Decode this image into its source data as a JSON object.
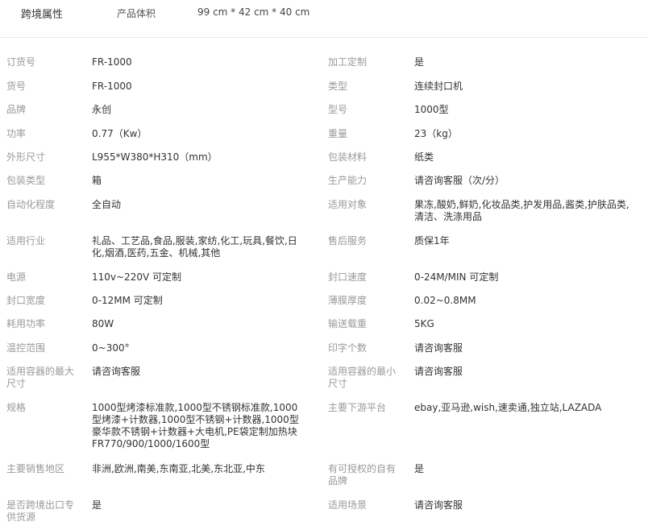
{
  "header": {
    "title": "跨境属性",
    "label": "产品体积",
    "value": "99 cm * 42 cm * 40 cm"
  },
  "rows": [
    {
      "l1": "订货号",
      "v1": "FR-1000",
      "l2": "加工定制",
      "v2": "是"
    },
    {
      "l1": "货号",
      "v1": "FR-1000",
      "l2": "类型",
      "v2": "连续封口机"
    },
    {
      "l1": "品牌",
      "v1": "永创",
      "l2": "型号",
      "v2": "1000型"
    },
    {
      "l1": "功率",
      "v1": "0.77（Kw）",
      "l2": "重量",
      "v2": "23（kg）"
    },
    {
      "l1": "外形尺寸",
      "v1": "L955*W380*H310（mm）",
      "l2": "包装材料",
      "v2": "纸类"
    },
    {
      "l1": "包装类型",
      "v1": "箱",
      "l2": "生产能力",
      "v2": "请咨询客服（次/分）"
    },
    {
      "l1": "自动化程度",
      "v1": "全自动",
      "l2": "适用对象",
      "v2": "果冻,酸奶,鲜奶,化妆品类,护发用品,酱类,护肤品类,清洁、洗涤用品"
    },
    {
      "l1": "适用行业",
      "v1": "礼品、工艺品,食品,服装,家纺,化工,玩具,餐饮,日化,烟酒,医药,五金、机械,其他",
      "l2": "售后服务",
      "v2": "质保1年"
    },
    {
      "l1": "电源",
      "v1": "110v~220V 可定制",
      "l2": "封口速度",
      "v2": "0-24M/MIN 可定制"
    },
    {
      "l1": "封口宽度",
      "v1": "0-12MM 可定制",
      "l2": "薄膜厚度",
      "v2": "0.02~0.8MM"
    },
    {
      "l1": "耗用功率",
      "v1": "80W",
      "l2": "输送载重",
      "v2": "5KG"
    },
    {
      "l1": "温控范围",
      "v1": "0~300°",
      "l2": "印字个数",
      "v2": "请咨询客服"
    },
    {
      "l1": "适用容器的最大尺寸",
      "v1": "请咨询客服",
      "l2": "适用容器的最小尺寸",
      "v2": "请咨询客服"
    },
    {
      "l1": "规格",
      "v1": "1000型烤漆标准款,1000型不锈钢标准款,1000型烤漆+计数器,1000型不锈钢+计数器,1000型豪华款不锈钢+计数器+大电机,PE袋定制加热块 FR770/900/1000/1600型",
      "l2": "主要下游平台",
      "v2": "ebay,亚马逊,wish,速卖通,独立站,LAZADA"
    },
    {
      "l1": "主要销售地区",
      "v1": "非洲,欧洲,南美,东南亚,北美,东北亚,中东",
      "l2": "有可授权的自有品牌",
      "v2": "是"
    },
    {
      "l1": "是否跨境出口专供货源",
      "v1": "是",
      "l2": "适用场景",
      "v2": "请咨询客服"
    }
  ]
}
